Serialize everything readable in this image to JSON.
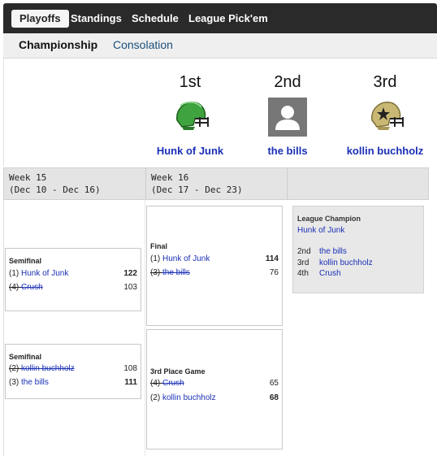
{
  "nav": {
    "tabs": [
      {
        "label": "Playoffs",
        "active": true
      },
      {
        "label": "Standings",
        "active": false
      },
      {
        "label": "Schedule",
        "active": false
      },
      {
        "label": "League Pick'em",
        "active": false
      }
    ]
  },
  "subnav": {
    "tabs": [
      {
        "label": "Championship",
        "active": true
      },
      {
        "label": "Consolation",
        "active": false
      }
    ]
  },
  "podium": [
    {
      "rank": "1st",
      "team": "Hunk of Junk",
      "icon": "green-helmet-icon",
      "color": "#3fa33f"
    },
    {
      "rank": "2nd",
      "team": "the bills",
      "icon": "default-avatar-icon",
      "color": "#777777"
    },
    {
      "rank": "3rd",
      "team": "kollin buchholz",
      "icon": "star-helmet-icon",
      "color": "#c9b874"
    }
  ],
  "weeks": [
    {
      "label": "Week 15",
      "range": "(Dec 10 - Dec 16)"
    },
    {
      "label": "Week 16",
      "range": "(Dec 17 - Dec 23)"
    }
  ],
  "matchups": {
    "semi1": {
      "title": "Semifinal",
      "rows": [
        {
          "seed": "(1)",
          "team": "Hunk of Junk",
          "score": "122",
          "won": true
        },
        {
          "seed": "(4)",
          "team": "Crush",
          "score": "103",
          "won": false
        }
      ]
    },
    "semi2": {
      "title": "Semifinal",
      "rows": [
        {
          "seed": "(2)",
          "team": "kollin buchholz",
          "score": "108",
          "won": false
        },
        {
          "seed": "(3)",
          "team": "the bills",
          "score": "111",
          "won": true
        }
      ]
    },
    "final": {
      "title": "Final",
      "rows": [
        {
          "seed": "(1)",
          "team": "Hunk of Junk",
          "score": "114",
          "won": true
        },
        {
          "seed": "(3)",
          "team": "the bills",
          "score": "76",
          "won": false
        }
      ]
    },
    "third": {
      "title": "3rd Place Game",
      "rows": [
        {
          "seed": "(4)",
          "team": "Crush",
          "score": "65",
          "won": false
        },
        {
          "seed": "(2)",
          "team": "kollin buchholz",
          "score": "68",
          "won": true
        }
      ]
    }
  },
  "champion": {
    "title": "League Champion",
    "team": "Hunk of Junk",
    "places": [
      {
        "place": "2nd",
        "team": "the bills"
      },
      {
        "place": "3rd",
        "team": "kollin buchholz"
      },
      {
        "place": "4th",
        "team": "Crush"
      }
    ]
  },
  "colors": {
    "link": "#1a2fb5",
    "nav_bg": "#2a2a2a",
    "subnav_active": "#111111",
    "subnav_link": "#1a4f7a"
  }
}
